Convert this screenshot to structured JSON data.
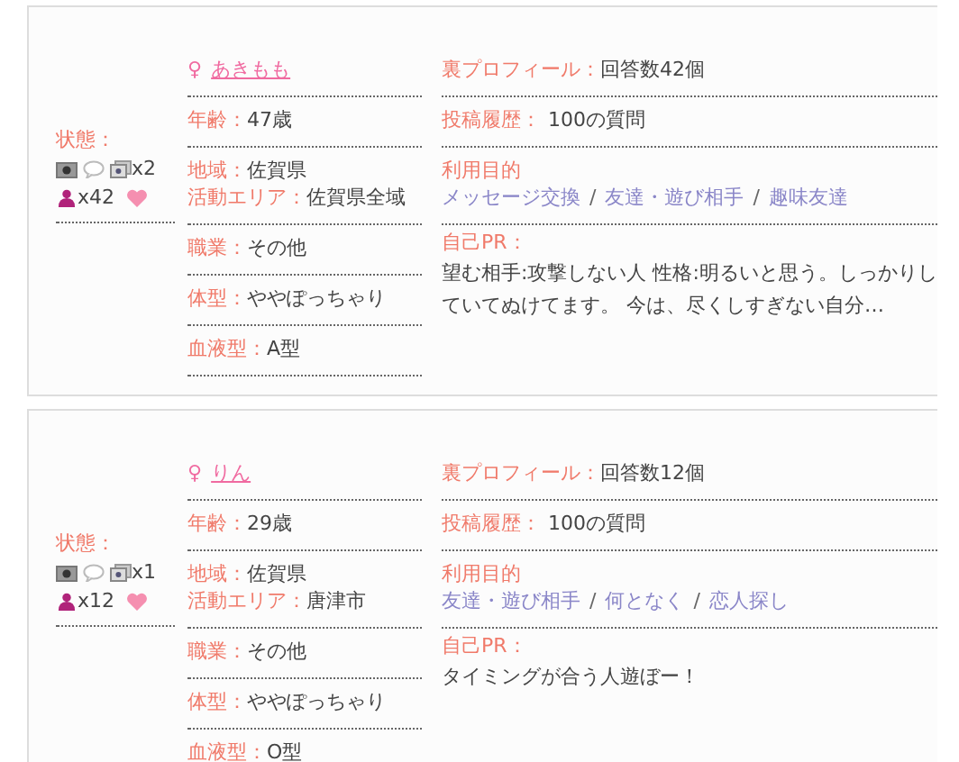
{
  "profiles": [
    {
      "gender": "♀",
      "name": "あきもも",
      "status_label": "状態：",
      "photo_count": "x2",
      "footprint_count": "x42",
      "details": [
        [
          {
            "label": "年齢：",
            "value": "47歳"
          }
        ],
        [
          {
            "label": "地域：",
            "value": "佐賀県"
          },
          {
            "label": "活動エリア：",
            "value": "佐賀県全域"
          }
        ],
        [
          {
            "label": "職業：",
            "value": "その他"
          }
        ],
        [
          {
            "label": "体型：",
            "value": "ややぽっちゃり"
          }
        ],
        [
          {
            "label": "血液型：",
            "value": "A型"
          }
        ]
      ],
      "back_profile": {
        "label": "裏プロフィール：",
        "value": "回答数42個"
      },
      "posts": {
        "label": "投稿履歴：",
        "value": "100の質問"
      },
      "purpose": {
        "label": "利用目的",
        "items": [
          {
            "kind": "link",
            "text": "メッセージ交換"
          },
          {
            "kind": "separator",
            "text": "/"
          },
          {
            "kind": "link",
            "text": "友達・遊び相手"
          },
          {
            "kind": "separator",
            "text": "/"
          },
          {
            "kind": "link",
            "text": "趣味友達"
          }
        ]
      },
      "pr": {
        "label": "自己PR：",
        "text": "望む相手:攻撃しない人 性格:明るいと思う。しっかりしていてぬけてます。 今は、尽くしすぎない自分…"
      }
    },
    {
      "gender": "♀",
      "name": "りん",
      "status_label": "状態：",
      "photo_count": "x1",
      "footprint_count": "x12",
      "details": [
        [
          {
            "label": "年齢：",
            "value": "29歳"
          }
        ],
        [
          {
            "label": "地域：",
            "value": "佐賀県"
          },
          {
            "label": "活動エリア：",
            "value": "唐津市"
          }
        ],
        [
          {
            "label": "職業：",
            "value": "その他"
          }
        ],
        [
          {
            "label": "体型：",
            "value": "ややぽっちゃり"
          }
        ],
        [
          {
            "label": "血液型：",
            "value": "O型"
          }
        ]
      ],
      "back_profile": {
        "label": "裏プロフィール：",
        "value": "回答数12個"
      },
      "posts": {
        "label": "投稿履歴：",
        "value": "100の質問"
      },
      "purpose": {
        "label": "利用目的",
        "items": [
          {
            "kind": "link",
            "text": "友達・遊び相手"
          },
          {
            "kind": "separator",
            "text": "/"
          },
          {
            "kind": "link",
            "text": "何となく"
          },
          {
            "kind": "separator",
            "text": "/"
          },
          {
            "kind": "link",
            "text": "恋人探し"
          }
        ]
      },
      "pr": {
        "label": "自己PR：",
        "text": "タイミングが合う人遊ぼー！"
      }
    }
  ]
}
